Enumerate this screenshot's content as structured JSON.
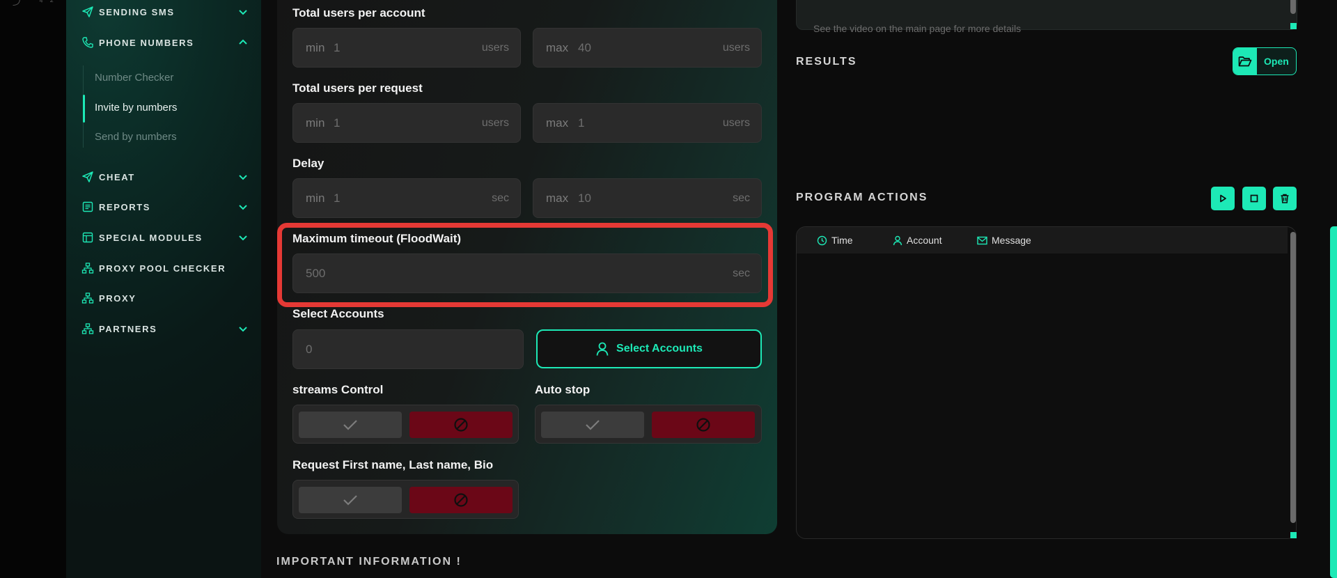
{
  "top_glyphs": "⤴ ⁴²",
  "sidebar": {
    "sending_sms": "SENDING SMS",
    "phone_numbers": "PHONE NUMBERS",
    "sub_items": [
      "Number Checker",
      "Invite by numbers",
      "Send by numbers"
    ],
    "cheat": "CHEAT",
    "reports": "REPORTS",
    "special_modules": "SPECIAL MODULES",
    "proxy_pool_checker": "PROXY POOL CHECKER",
    "proxy": "PROXY",
    "partners": "PARTNERS"
  },
  "form": {
    "users_per_account": {
      "label": "Total users per account",
      "min_prefix": "min",
      "min": "1",
      "min_unit": "users",
      "max_prefix": "max",
      "max": "40",
      "max_unit": "users"
    },
    "users_per_request": {
      "label": "Total users per request",
      "min_prefix": "min",
      "min": "1",
      "min_unit": "users",
      "max_prefix": "max",
      "max": "1",
      "max_unit": "users"
    },
    "delay": {
      "label": "Delay",
      "min_prefix": "min",
      "min": "1",
      "min_unit": "sec",
      "max_prefix": "max",
      "max": "10",
      "max_unit": "sec"
    },
    "floodwait": {
      "label": "Maximum timeout (FloodWait)",
      "value": "500",
      "unit": "sec"
    },
    "select_accounts": {
      "label": "Select Accounts",
      "value": "0",
      "button": "Select Accounts"
    },
    "streams_control": {
      "label": "streams Control"
    },
    "auto_stop": {
      "label": "Auto stop"
    },
    "request_names": {
      "label": "Request First name, Last name, Bio"
    }
  },
  "important_info": "IMPORTANT INFORMATION !",
  "right": {
    "hint": "See the video on the main page for more details",
    "results_title": "RESULTS",
    "open_button": "Open",
    "program_actions_title": "PROGRAM ACTIONS",
    "log_columns": [
      "Time",
      "Account",
      "Message"
    ]
  },
  "colors": {
    "accent": "#1de9b6",
    "danger": "#6b0717",
    "highlight": "#e53935"
  }
}
